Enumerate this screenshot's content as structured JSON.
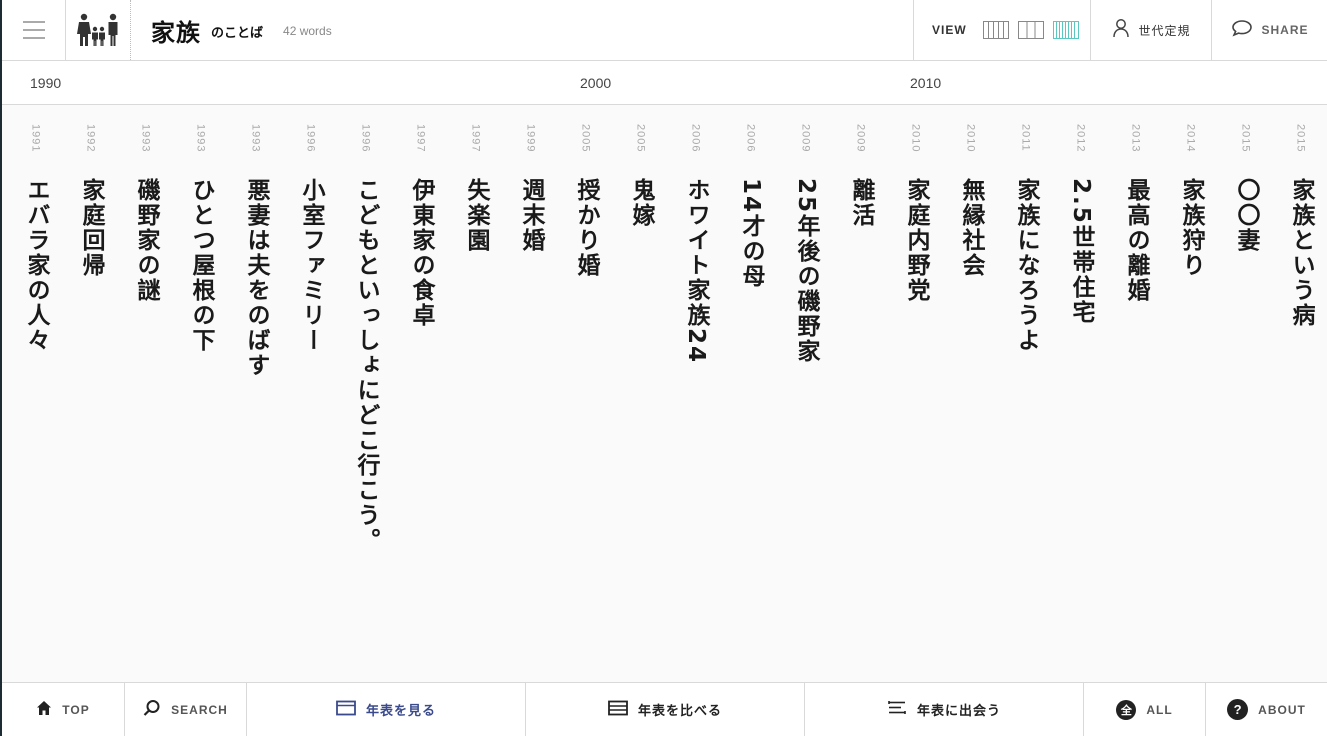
{
  "header": {
    "title": "家族",
    "subtitle": "のことば",
    "word_count": "42 words",
    "view_label": "VIEW",
    "generation_label": "世代定規",
    "share_label": "SHARE",
    "active_view_color": "#5cc6c0"
  },
  "ruler": {
    "decades": [
      "1990",
      "2000",
      "2010"
    ]
  },
  "timeline": {
    "entries": [
      {
        "year": "1991",
        "word": "エバラ家の人々"
      },
      {
        "year": "1992",
        "word": "家庭回帰"
      },
      {
        "year": "1993",
        "word": "磯野家の謎"
      },
      {
        "year": "1993",
        "word": "ひとつ屋根の下"
      },
      {
        "year": "1993",
        "word": "悪妻は夫をのばす"
      },
      {
        "year": "1996",
        "word": "小室ファミリー"
      },
      {
        "year": "1996",
        "word": "こどもといっしょにどこ行こう。"
      },
      {
        "year": "1997",
        "word": "伊東家の食卓"
      },
      {
        "year": "1997",
        "word": "失楽園"
      },
      {
        "year": "1999",
        "word": "週末婚"
      },
      {
        "year": "2005",
        "word": "授かり婚"
      },
      {
        "year": "2005",
        "word": "鬼嫁"
      },
      {
        "year": "2006",
        "word": "ホワイト家族24"
      },
      {
        "year": "2006",
        "word": "14才の母"
      },
      {
        "year": "2009",
        "word": "25年後の磯野家"
      },
      {
        "year": "2009",
        "word": "離活"
      },
      {
        "year": "2010",
        "word": "家庭内野党"
      },
      {
        "year": "2010",
        "word": "無縁社会"
      },
      {
        "year": "2011",
        "word": "家族になろうよ"
      },
      {
        "year": "2012",
        "word": "2.5世帯住宅"
      },
      {
        "year": "2013",
        "word": "最高の離婚"
      },
      {
        "year": "2014",
        "word": "家族狩り"
      },
      {
        "year": "2015",
        "word": "〇〇妻"
      },
      {
        "year": "2015",
        "word": "家族という病"
      }
    ]
  },
  "footer": {
    "top_label": "TOP",
    "search_label": "SEARCH",
    "view_timeline_label": "年表を見る",
    "compare_label": "年表を比べる",
    "meet_label": "年表に出会う",
    "all_label": "ALL",
    "all_badge": "全",
    "about_label": "ABOUT",
    "about_badge": "?",
    "active_color": "#3a4a8c"
  }
}
